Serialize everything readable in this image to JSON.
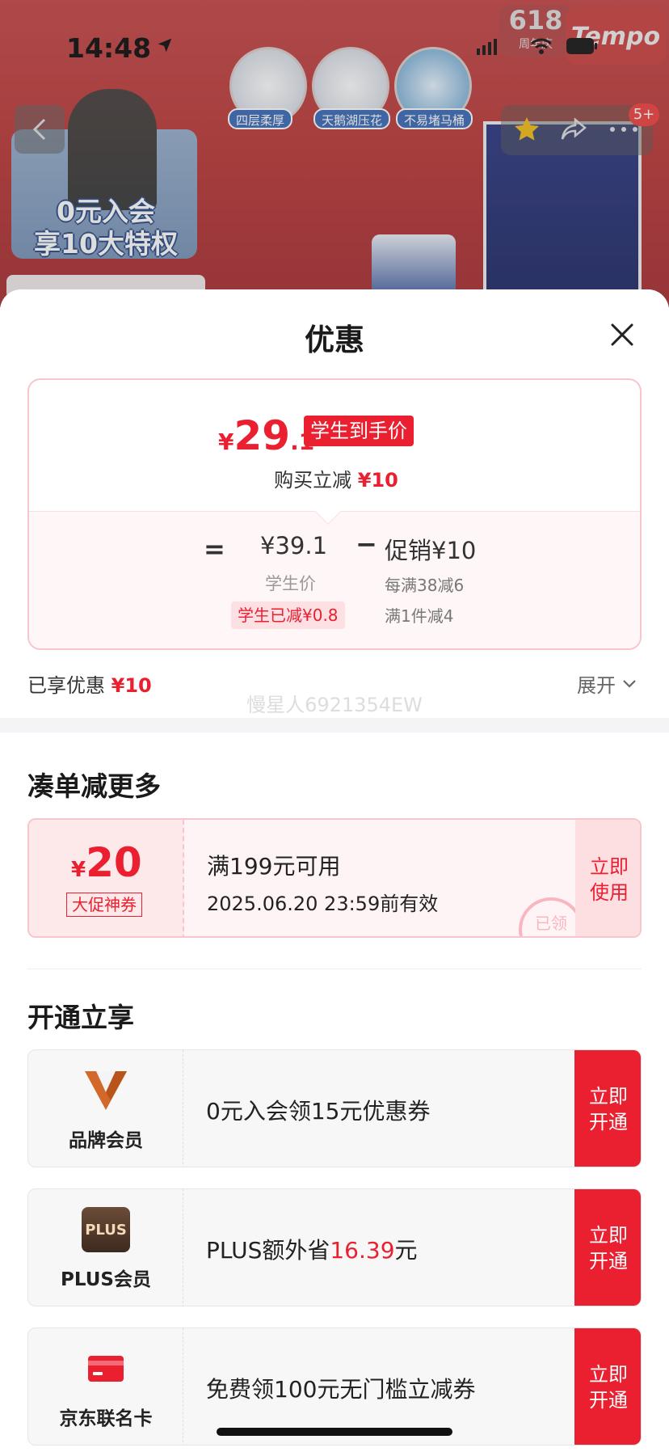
{
  "status": {
    "time": "14:48"
  },
  "background": {
    "chips": [
      "四层柔厚",
      "天鹅湖压花",
      "不易堵马桶"
    ],
    "promo_text": "0元入会\n享10大特权",
    "badge_618": "618",
    "badge_618_sub": "周年庆",
    "brand": "Tempo",
    "cart_count": "5+"
  },
  "sheet": {
    "title": "优惠",
    "price": {
      "currency": "¥",
      "integer": "29",
      "decimal": ".1",
      "tag": "学生到手价",
      "reduce_label": "购买立减",
      "reduce_value": "¥10",
      "equals": "=",
      "student_price": "¥39.1",
      "student_price_label": "学生价",
      "student_discount": "学生已减¥0.8",
      "minus": "−",
      "promo_label": "促销¥10",
      "rule1": "每满38减6",
      "rule2": "满1件减4"
    },
    "enjoyed_label": "已享优惠",
    "enjoyed_value": "¥10",
    "expand_label": "展开",
    "watermark": "慢星人6921354EW"
  },
  "more_section": {
    "title": "凑单减更多",
    "coupon": {
      "currency": "¥",
      "amount": "20",
      "tag": "大促神券",
      "condition": "满199元可用",
      "validity": "2025.06.20 23:59前有效",
      "action": "立即\n使用",
      "stamp": "已领"
    }
  },
  "join_section": {
    "title": "开通立享",
    "items": [
      {
        "label": "品牌会员",
        "desc": "0元入会领15元优惠券",
        "highlight": "",
        "suffix": "",
        "action": "立即\n开通",
        "icon": "brand-v-icon"
      },
      {
        "label": "PLUS会员",
        "desc": "PLUS额外省",
        "highlight": "16.39",
        "suffix": "元",
        "action": "立即\n开通",
        "icon": "plus-badge-icon"
      },
      {
        "label": "京东联名卡",
        "desc": "免费领100元无门槛立减券",
        "highlight": "",
        "suffix": "",
        "action": "立即\n开通",
        "icon": "credit-card-icon"
      }
    ],
    "plus_badge_text": "PLUS"
  },
  "colors": {
    "accent": "#ea1f2f",
    "brand_v": "#d2692a"
  }
}
